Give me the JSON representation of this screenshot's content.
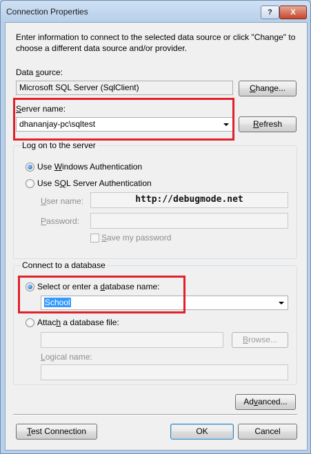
{
  "window": {
    "title": "Connection Properties",
    "help_label": "?",
    "close_label": "X"
  },
  "description": "Enter information to connect to the selected data source or click \"Change\" to choose a different data source and/or provider.",
  "data_source": {
    "label": "Data source:",
    "value": "Microsoft SQL Server (SqlClient)",
    "change_button": "Change..."
  },
  "server": {
    "label": "Server name:",
    "value": "dhananjay-pc\\sqltest",
    "refresh_button": "Refresh"
  },
  "logon": {
    "group_label": "Log on to the server",
    "windows_auth": "Use Windows Authentication",
    "sql_auth": "Use SQL Server Authentication",
    "selected": "windows",
    "user_name_label": "User name:",
    "user_name_value": "http://debugmode.net",
    "password_label": "Password:",
    "password_value": "",
    "save_password_label": "Save my password"
  },
  "database": {
    "group_label": "Connect to a database",
    "select_option": "Select or enter a database name:",
    "database_name": "School",
    "attach_option": "Attach a database file:",
    "attach_value": "",
    "browse_button": "Browse...",
    "logical_name_label": "Logical name:",
    "logical_name_value": ""
  },
  "buttons": {
    "advanced": "Advanced...",
    "test_connection": "Test Connection",
    "ok": "OK",
    "cancel": "Cancel"
  },
  "colors": {
    "highlight_box": "#e0202a",
    "selection": "#3399ff"
  }
}
